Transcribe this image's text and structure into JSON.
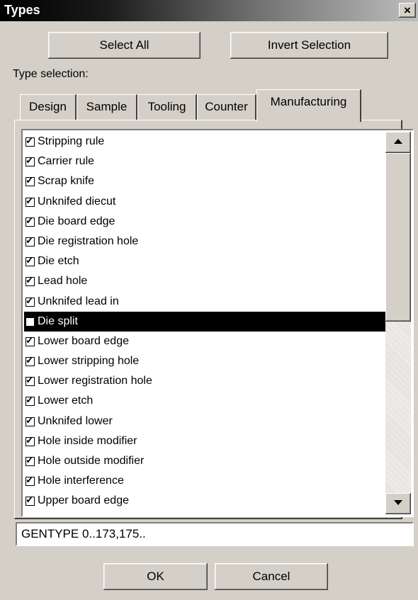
{
  "window": {
    "title": "Types",
    "close_glyph": "×"
  },
  "buttons": {
    "select_all": "Select All",
    "invert_selection": "Invert Selection",
    "ok": "OK",
    "cancel": "Cancel"
  },
  "type_selection_label": "Type selection:",
  "tabs": [
    {
      "label": "Design",
      "active": false
    },
    {
      "label": "Sample",
      "active": false
    },
    {
      "label": "Tooling",
      "active": false
    },
    {
      "label": "Counter",
      "active": false
    },
    {
      "label": "Manufacturing",
      "active": true
    }
  ],
  "list": {
    "items": [
      {
        "label": "Stripping rule",
        "checked": true
      },
      {
        "label": "Carrier rule",
        "checked": true
      },
      {
        "label": "Scrap knife",
        "checked": true
      },
      {
        "label": "Unknifed diecut",
        "checked": true
      },
      {
        "label": "Die board edge",
        "checked": true
      },
      {
        "label": "Die registration hole",
        "checked": true
      },
      {
        "label": "Die etch",
        "checked": true
      },
      {
        "label": "Lead hole",
        "checked": true
      },
      {
        "label": "Unknifed lead in",
        "checked": true
      },
      {
        "label": "Die split",
        "checked": false,
        "selected": true
      },
      {
        "label": "Lower board edge",
        "checked": true
      },
      {
        "label": "Lower stripping hole",
        "checked": true
      },
      {
        "label": "Lower registration hole",
        "checked": true
      },
      {
        "label": "Lower etch",
        "checked": true
      },
      {
        "label": "Unknifed lower",
        "checked": true
      },
      {
        "label": "Hole inside modifier",
        "checked": true
      },
      {
        "label": "Hole outside modifier",
        "checked": true
      },
      {
        "label": "Hole interference",
        "checked": true
      },
      {
        "label": "Upper board edge",
        "checked": true
      }
    ],
    "scrollbar": {
      "up_icon": "scroll-up-arrow",
      "down_icon": "scroll-down-arrow"
    }
  },
  "gentype_field": {
    "value": "GENTYPE 0..173,175.."
  }
}
